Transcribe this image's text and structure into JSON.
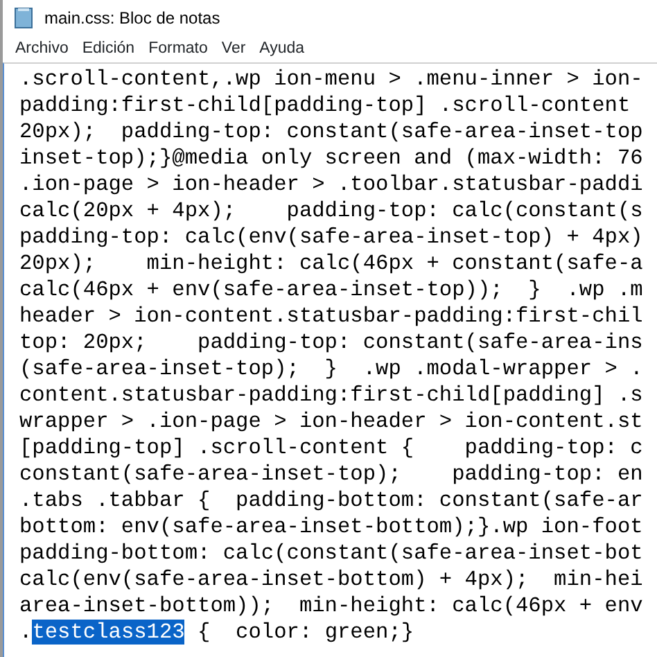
{
  "window": {
    "title": "main.css: Bloc de notas"
  },
  "menu": [
    "Archivo",
    "Edición",
    "Formato",
    "Ver",
    "Ayuda"
  ],
  "lines": [
    {
      "segments": [
        {
          "text": ".scroll-content,.wp ion-menu > .menu-inner > ion-",
          "selected": false
        }
      ]
    },
    {
      "segments": [
        {
          "text": "padding:first-child[padding-top] .scroll-content",
          "selected": false
        }
      ]
    },
    {
      "segments": [
        {
          "text": "20px);  padding-top: constant(safe-area-inset-top",
          "selected": false
        }
      ]
    },
    {
      "segments": [
        {
          "text": "inset-top);}@media only screen and (max-width: 76",
          "selected": false
        }
      ]
    },
    {
      "segments": [
        {
          "text": ".ion-page > ion-header > .toolbar.statusbar-paddi",
          "selected": false
        }
      ]
    },
    {
      "segments": [
        {
          "text": "calc(20px + 4px);    padding-top: calc(constant(s",
          "selected": false
        }
      ]
    },
    {
      "segments": [
        {
          "text": "padding-top: calc(env(safe-area-inset-top) + 4px)",
          "selected": false
        }
      ]
    },
    {
      "segments": [
        {
          "text": "20px);    min-height: calc(46px + constant(safe-a",
          "selected": false
        }
      ]
    },
    {
      "segments": [
        {
          "text": "calc(46px + env(safe-area-inset-top));  }  .wp .m",
          "selected": false
        }
      ]
    },
    {
      "segments": [
        {
          "text": "header > ion-content.statusbar-padding:first-chil",
          "selected": false
        }
      ]
    },
    {
      "segments": [
        {
          "text": "top: 20px;    padding-top: constant(safe-area-ins",
          "selected": false
        }
      ]
    },
    {
      "segments": [
        {
          "text": "(safe-area-inset-top);  }  .wp .modal-wrapper > .",
          "selected": false
        }
      ]
    },
    {
      "segments": [
        {
          "text": "content.statusbar-padding:first-child[padding] .s",
          "selected": false
        }
      ]
    },
    {
      "segments": [
        {
          "text": "wrapper > .ion-page > ion-header > ion-content.st",
          "selected": false
        }
      ]
    },
    {
      "segments": [
        {
          "text": "[padding-top] .scroll-content {    padding-top: c",
          "selected": false
        }
      ]
    },
    {
      "segments": [
        {
          "text": "constant(safe-area-inset-top);    padding-top: en",
          "selected": false
        }
      ]
    },
    {
      "segments": [
        {
          "text": ".tabs .tabbar {  padding-bottom: constant(safe-ar",
          "selected": false
        }
      ]
    },
    {
      "segments": [
        {
          "text": "bottom: env(safe-area-inset-bottom);}.wp ion-foot",
          "selected": false
        }
      ]
    },
    {
      "segments": [
        {
          "text": "padding-bottom: calc(constant(safe-area-inset-bot",
          "selected": false
        }
      ]
    },
    {
      "segments": [
        {
          "text": "calc(env(safe-area-inset-bottom) + 4px);  min-hei",
          "selected": false
        }
      ]
    },
    {
      "segments": [
        {
          "text": "area-inset-bottom));  min-height: calc(46px + env",
          "selected": false
        }
      ]
    },
    {
      "segments": [
        {
          "text": ".",
          "selected": false
        },
        {
          "text": "testclass123",
          "selected": true
        },
        {
          "text": " {  color: green;}",
          "selected": false
        }
      ]
    }
  ]
}
